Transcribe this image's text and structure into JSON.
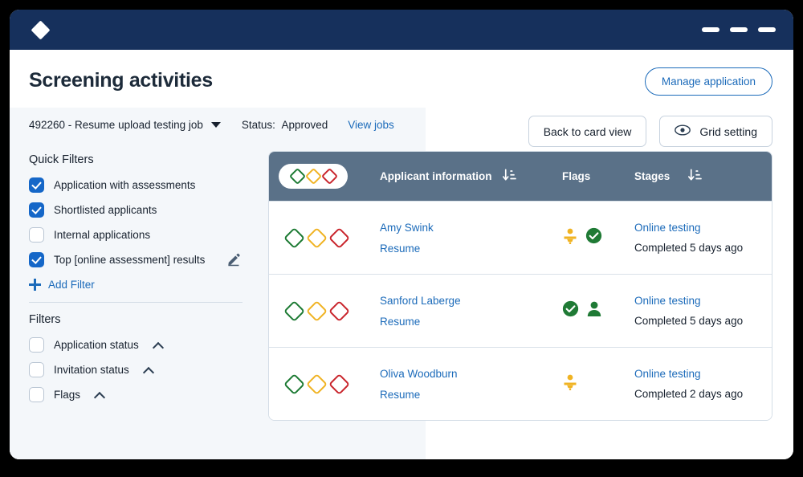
{
  "navbar": {
    "logo_icon": "diamond-logo-icon",
    "placeholder_items": [
      "",
      "",
      ""
    ]
  },
  "header": {
    "title": "Screening activities",
    "manage_application_label": "Manage application"
  },
  "jobbar": {
    "job_label": "492260 - Resume upload testing job",
    "status_prefix": "Status:",
    "status_value": "Approved",
    "view_jobs_label": "View jobs"
  },
  "actions": {
    "back_to_card_view": "Back to card view",
    "grid_setting": "Grid setting",
    "grid_setting_icon": "eye-icon"
  },
  "sidebar": {
    "quick_filters_title": "Quick Filters",
    "quick_filters": [
      {
        "label": "Application with assessments",
        "checked": true,
        "editable": false
      },
      {
        "label": "Shortlisted applicants",
        "checked": true,
        "editable": false
      },
      {
        "label": "Internal applications",
        "checked": false,
        "editable": false
      },
      {
        "label": "Top [online assessment] results",
        "checked": true,
        "editable": true
      }
    ],
    "add_filter_label": "Add Filter",
    "filters_title": "Filters",
    "filters": [
      {
        "label": "Application status",
        "checked": false,
        "expandable": true
      },
      {
        "label": "Invitation status",
        "checked": false,
        "expandable": true
      },
      {
        "label": "Flags",
        "checked": false,
        "expandable": true
      }
    ]
  },
  "grid": {
    "columns": {
      "diamonds": "",
      "applicant_information": "Applicant information",
      "flags": "Flags",
      "stages": "Stages"
    },
    "sort_icon": "sort-descending-icon",
    "rows": [
      {
        "name": "Amy Swink",
        "resume_label": "Resume",
        "flags": [
          "shortlisted-person-yellow-icon",
          "check-circle-green-icon"
        ],
        "stage": "Online testing",
        "stage_status": "Completed 5 days ago"
      },
      {
        "name": "Sanford Laberge",
        "resume_label": "Resume",
        "flags": [
          "check-circle-green-icon",
          "person-green-icon"
        ],
        "stage": "Online testing",
        "stage_status": "Completed 5 days ago"
      },
      {
        "name": "Oliva Woodburn",
        "resume_label": "Resume",
        "flags": [
          "shortlisted-person-yellow-icon"
        ],
        "stage": "Online testing",
        "stage_status": "Completed 2 days ago"
      }
    ]
  },
  "colors": {
    "navbar": "#16305c",
    "accent_link": "#1c6bba",
    "checkbox_checked": "#1567c8",
    "grid_header": "#5a7188",
    "panel_bg": "#f4f7fa",
    "flag_green": "#1f7a35",
    "flag_yellow": "#f0b323",
    "diamond_green": "#1c7a33",
    "diamond_yellow": "#f0b323",
    "diamond_red": "#c9252c"
  }
}
